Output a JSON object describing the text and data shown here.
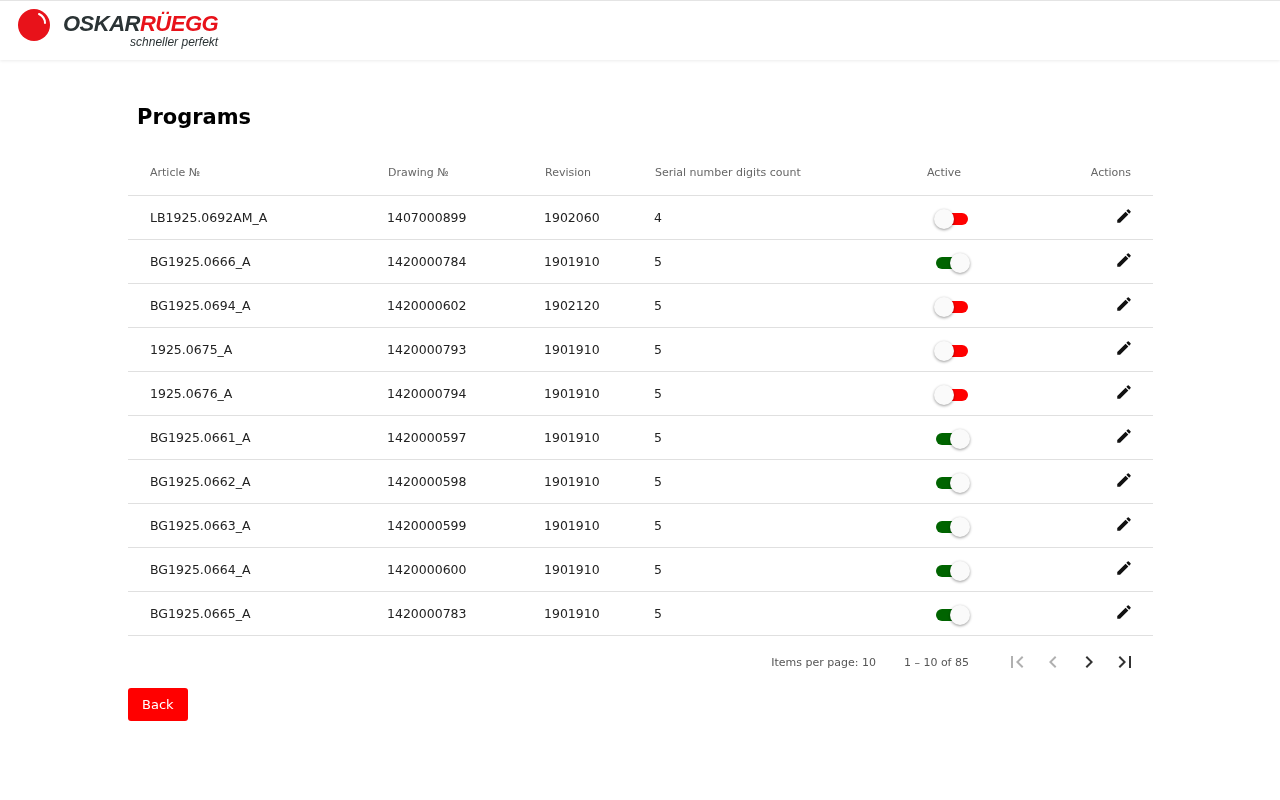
{
  "header": {
    "logo": {
      "name_first": "OSKAR",
      "name_second": "RÜEGG",
      "tagline": "schneller perfekt"
    }
  },
  "title": "Programs",
  "table": {
    "columns": [
      "Article №",
      "Drawing №",
      "Revision",
      "Serial number digits count",
      "Active",
      "Actions"
    ],
    "rows": [
      {
        "article": "LB1925.0692AM_A",
        "drawing": "1407000899",
        "revision": "1902060",
        "digits": "4",
        "active": false
      },
      {
        "article": "BG1925.0666_A",
        "drawing": "1420000784",
        "revision": "1901910",
        "digits": "5",
        "active": true
      },
      {
        "article": "BG1925.0694_A",
        "drawing": "1420000602",
        "revision": "1902120",
        "digits": "5",
        "active": false
      },
      {
        "article": "1925.0675_A",
        "drawing": "1420000793",
        "revision": "1901910",
        "digits": "5",
        "active": false
      },
      {
        "article": "1925.0676_A",
        "drawing": "1420000794",
        "revision": "1901910",
        "digits": "5",
        "active": false
      },
      {
        "article": "BG1925.0661_A",
        "drawing": "1420000597",
        "revision": "1901910",
        "digits": "5",
        "active": true
      },
      {
        "article": "BG1925.0662_A",
        "drawing": "1420000598",
        "revision": "1901910",
        "digits": "5",
        "active": true
      },
      {
        "article": "BG1925.0663_A",
        "drawing": "1420000599",
        "revision": "1901910",
        "digits": "5",
        "active": true
      },
      {
        "article": "BG1925.0664_A",
        "drawing": "1420000600",
        "revision": "1901910",
        "digits": "5",
        "active": true
      },
      {
        "article": "BG1925.0665_A",
        "drawing": "1420000783",
        "revision": "1901910",
        "digits": "5",
        "active": true
      }
    ]
  },
  "paginator": {
    "items_per_page": "Items per page: 10",
    "range": "1 – 10 of 85",
    "buttons": [
      {
        "kind": "first",
        "disabled": true
      },
      {
        "kind": "prev",
        "disabled": true
      },
      {
        "kind": "next",
        "disabled": false
      },
      {
        "kind": "last",
        "disabled": false
      }
    ]
  },
  "back_button": "Back"
}
